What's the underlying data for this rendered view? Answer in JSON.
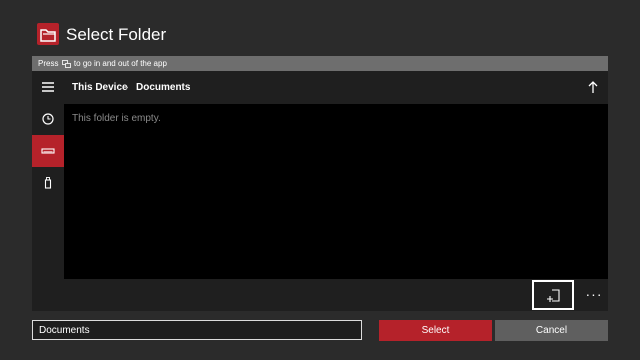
{
  "app": {
    "title": "Select Folder",
    "icon": "folder-icon",
    "accent_color": "#b5222a"
  },
  "hint": {
    "prefix": "Press",
    "icon": "view-button-icon",
    "suffix": "to go in and out of the app"
  },
  "sidebar": {
    "items": [
      {
        "name": "menu",
        "icon": "hamburger-icon",
        "active": false
      },
      {
        "name": "recent",
        "icon": "clock-icon",
        "active": false
      },
      {
        "name": "this-device",
        "icon": "drive-icon",
        "active": true
      },
      {
        "name": "usb",
        "icon": "usb-drive-icon",
        "active": false
      }
    ]
  },
  "path": {
    "crumbs": [
      "This Device",
      "Documents"
    ],
    "separator": "›",
    "up_icon": "arrow-up-icon"
  },
  "content": {
    "empty_message": "This folder is empty."
  },
  "bottom_bar": {
    "new_folder_icon": "new-folder-icon",
    "more_label": "···"
  },
  "footer": {
    "folder_name_value": "Documents",
    "select_label": "Select",
    "cancel_label": "Cancel"
  }
}
